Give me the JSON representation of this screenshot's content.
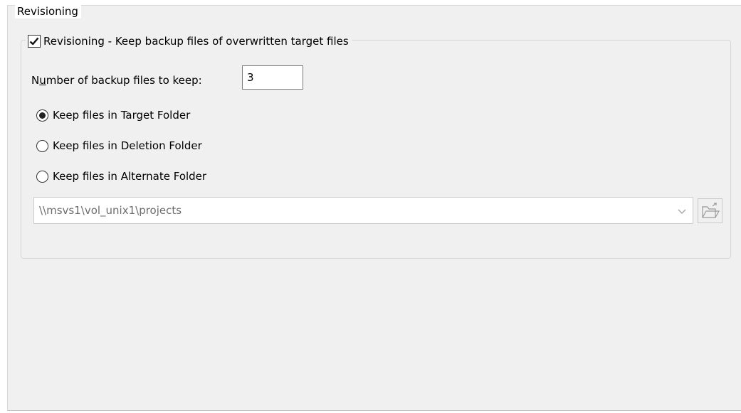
{
  "group": {
    "title": "Revisioning"
  },
  "revisioning": {
    "checkbox_label": "Revisioning - Keep backup files of overwritten target files",
    "checked": true
  },
  "backups": {
    "label_prefix": "N",
    "label_underlined": "u",
    "label_rest": "mber of backup files to keep:",
    "value": "3"
  },
  "radios": [
    {
      "label": "Keep files in Target Folder",
      "selected": true
    },
    {
      "label": "Keep files in Deletion Folder",
      "selected": false
    },
    {
      "label": "Keep files in Alternate Folder",
      "selected": false
    }
  ],
  "alternate_folder": {
    "path": "\\\\msvs1\\vol_unix1\\projects",
    "enabled": false
  },
  "icons": {
    "combo": "chevron-down-icon",
    "browse": "folder-open-icon",
    "checkbox": "checkmark-icon"
  }
}
